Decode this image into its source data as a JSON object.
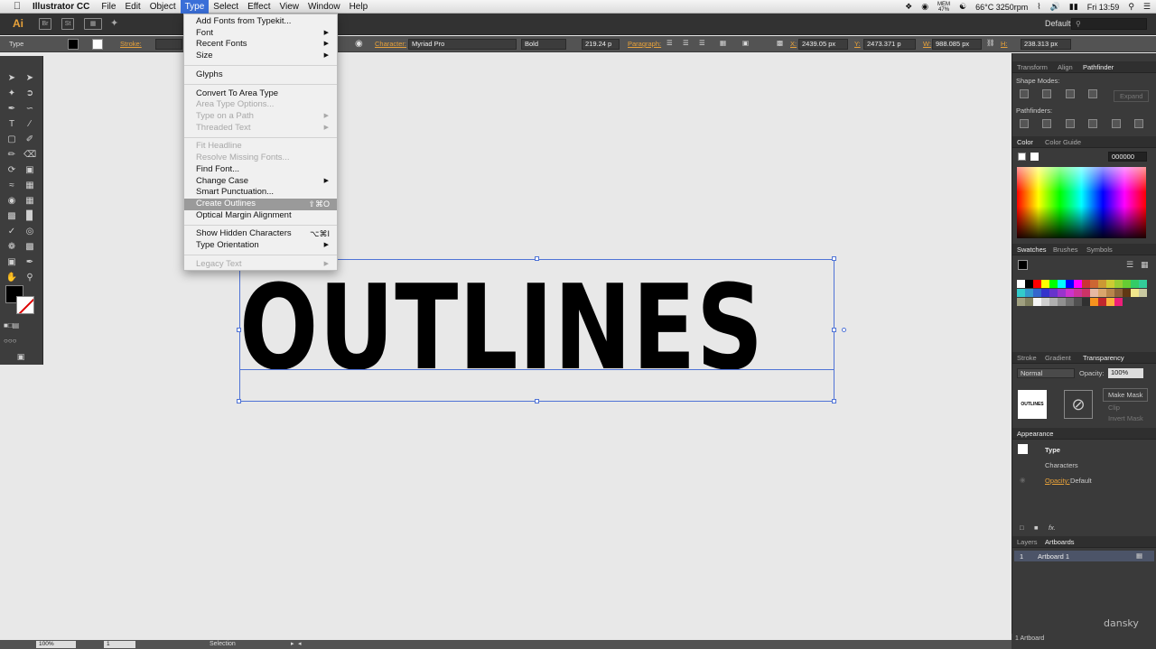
{
  "menubar": {
    "app_name": "Illustrator CC",
    "menus": [
      "File",
      "Edit",
      "Object",
      "Type",
      "Select",
      "Effect",
      "View",
      "Window",
      "Help"
    ],
    "active_menu": "Type",
    "mem_label": "MEM",
    "mem_value": "47%",
    "temp": "66°C 3250rpm",
    "clock": "Fri 13:59"
  },
  "appbar": {
    "logo": "Ai",
    "workspace": "Default"
  },
  "controlbar": {
    "mode": "Type",
    "stroke_label": "Stroke:",
    "character_label": "Character:",
    "font_family": "Myriad Pro",
    "font_style": "Bold",
    "font_size": "219.24 p",
    "paragraph_label": "Paragraph:",
    "x_label": "X:",
    "x_value": "2439.05 px",
    "y_label": "Y:",
    "y_value": "2473.371 p",
    "w_label": "W:",
    "w_value": "988.085 px",
    "h_label": "H:",
    "h_value": "238.313 px"
  },
  "canvas": {
    "text": "OUTLINES"
  },
  "type_menu": {
    "items": [
      {
        "label": "Add Fonts from Typekit...",
        "disabled": false
      },
      {
        "label": "Font",
        "disabled": false,
        "submenu": true
      },
      {
        "label": "Recent Fonts",
        "disabled": false,
        "submenu": true
      },
      {
        "label": "Size",
        "disabled": false,
        "submenu": true
      },
      {
        "sep": true
      },
      {
        "label": "Glyphs",
        "disabled": false
      },
      {
        "sep": true
      },
      {
        "label": "Convert To Area Type",
        "disabled": false
      },
      {
        "label": "Area Type Options...",
        "disabled": true
      },
      {
        "label": "Type on a Path",
        "disabled": true,
        "submenu": true
      },
      {
        "label": "Threaded Text",
        "disabled": true,
        "submenu": true
      },
      {
        "sep": true
      },
      {
        "label": "Fit Headline",
        "disabled": true
      },
      {
        "label": "Resolve Missing Fonts...",
        "disabled": true
      },
      {
        "label": "Find Font...",
        "disabled": false
      },
      {
        "label": "Change Case",
        "disabled": false,
        "submenu": true
      },
      {
        "label": "Smart Punctuation...",
        "disabled": false
      },
      {
        "label": "Create Outlines",
        "disabled": false,
        "shortcut": "⇧⌘O",
        "highlighted": true
      },
      {
        "label": "Optical Margin Alignment",
        "disabled": false
      },
      {
        "sep": true
      },
      {
        "label": "Show Hidden Characters",
        "disabled": false,
        "shortcut": "⌥⌘I"
      },
      {
        "label": "Type Orientation",
        "disabled": false,
        "submenu": true
      },
      {
        "sep": true
      },
      {
        "label": "Legacy Text",
        "disabled": true,
        "submenu": true
      }
    ]
  },
  "panels": {
    "transform_tabs": [
      "Transform",
      "Align",
      "Pathfinder"
    ],
    "shape_modes": "Shape Modes:",
    "expand": "Expand",
    "pathfinders": "Pathfinders:",
    "color_tabs": [
      "Color",
      "Color Guide"
    ],
    "hex": "000000",
    "swatches_tabs": [
      "Swatches",
      "Brushes",
      "Symbols"
    ],
    "stroke_tabs": [
      "Stroke",
      "Gradient",
      "Transparency"
    ],
    "blend_mode": "Normal",
    "opacity_label": "Opacity:",
    "opacity_value": "100%",
    "thumb_text": "OUTLINES",
    "make_mask": "Make Mask",
    "clip": "Clip",
    "invert_mask": "Invert Mask",
    "appearance_title": "Appearance",
    "appearance_type": "Type",
    "appearance_characters": "Characters",
    "appearance_opacity_label": "Opacity:",
    "appearance_opacity_value": "Default",
    "layers_tabs": [
      "Layers",
      "Artboards"
    ],
    "artboard_num": "1",
    "artboard_name": "Artboard 1",
    "artboard_count": "1 Artboard"
  },
  "statusbar": {
    "zoom": "100%",
    "page": "1",
    "tool": "Selection"
  },
  "watermark": "dansky"
}
